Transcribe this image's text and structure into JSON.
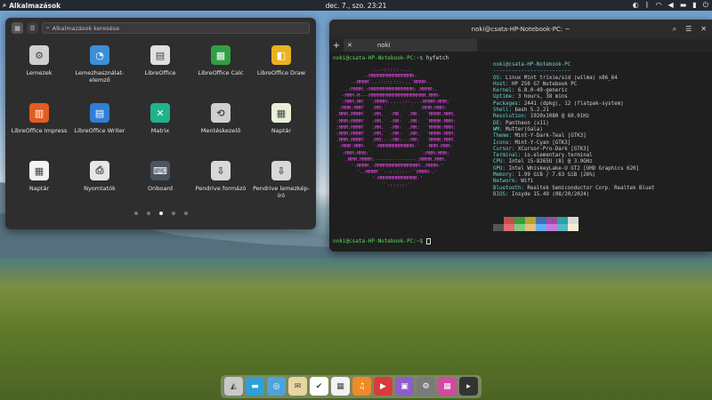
{
  "panel": {
    "apps_label": "Alkalmazások",
    "clock": "dec. 7., szo.   23:21"
  },
  "launcher": {
    "search_placeholder": "Alkalmazások keresése",
    "apps": [
      {
        "label": "Lemezek",
        "icon": "disks-icon",
        "color": "#d0d0d0",
        "glyph": "⚙"
      },
      {
        "label": "Lemezhasználat-elemző",
        "icon": "disk-usage-icon",
        "color": "#3a8fd8",
        "glyph": "◔"
      },
      {
        "label": "LibreOffice",
        "icon": "libreoffice-icon",
        "color": "#e0e0e0",
        "glyph": "▤"
      },
      {
        "label": "LibreOffice Calc",
        "icon": "libreoffice-calc-icon",
        "color": "#2ea043",
        "glyph": "▦"
      },
      {
        "label": "LibreOffice Draw",
        "icon": "libreoffice-draw-icon",
        "color": "#e9b21f",
        "glyph": "◧"
      },
      {
        "label": "LibreOffice Impress",
        "icon": "libreoffice-impress-icon",
        "color": "#e35d1e",
        "glyph": "▥"
      },
      {
        "label": "LibreOffice Writer",
        "icon": "libreoffice-writer-icon",
        "color": "#2f7fd6",
        "glyph": "▤"
      },
      {
        "label": "Matrix",
        "icon": "matrix-icon",
        "color": "#1fb38a",
        "glyph": "✕"
      },
      {
        "label": "Mentéskezelő",
        "icon": "backup-icon",
        "color": "#cfcfcf",
        "glyph": "⟲"
      },
      {
        "label": "Naptár",
        "icon": "calendar-icon",
        "color": "#e8f0d8",
        "glyph": "▦"
      },
      {
        "label": "Naptár",
        "icon": "calendar-red-icon",
        "color": "#f2f2f2",
        "glyph": "▦"
      },
      {
        "label": "Nyomtatók",
        "icon": "printer-icon",
        "color": "#e6e6e6",
        "glyph": "⎙"
      },
      {
        "label": "Onboard",
        "icon": "keyboard-icon",
        "color": "#4a5560",
        "glyph": "⌨"
      },
      {
        "label": "Pendrive formázó",
        "icon": "usb-format-icon",
        "color": "#d8d8d8",
        "glyph": "⇩"
      },
      {
        "label": "Pendrive lemezkép-író",
        "icon": "usb-writer-icon",
        "color": "#d8d8d8",
        "glyph": "⇩"
      }
    ],
    "page_count": 5,
    "active_page": 3
  },
  "terminal": {
    "title": "noki@csata-HP-Notebook-PC: ~",
    "tab_label": "noki",
    "prompt": "noki@csata-HP-Notebook-PC:~$",
    "command": "hyfetch",
    "logo_lines": [
      "             ...-:::::-...",
      "          .-MMMMMMMMMMMMMMM-.",
      "      .-MMMM`..-:::::::-..`MMMM-.",
      "    .:MMMM.:MMMMMMMMMMMMMMM:.MMMM:.",
      "   -MMM-M---MMMMMMMMMMMMMMMMMMM.MMM-",
      "  `:MMM:MM`  :MMMM:....::-...-MMMM:MMM:`",
      "  :MMM:MMM`  :MM:`  `  `  `  :MMM:MMM:",
      " .MMM.MMMM`  :MM.  -MM.  .MM-  `MMMM.MMM.",
      " :MMM:MMMM`  :MM.  -MM-  .MM:  `MMMM-MMM:",
      " :MMM:MMMM`  :MM.  -MM-  .MM:  `MMMM:MMM:",
      " :MMM:MMMM`  :MM.  -MM-  .MM:  `MMMM-MMM:",
      " .MMM.MMMM`  :MM:--:MM:--:MM:  `MMMM.MMM.",
      "  :MMM:MMM-  `-MMMMMMMMMMMM-`  -MMM-MMM:",
      "   :MMM:MMM:`                `:MMM:MMM:",
      "    .MMM.MMMM:--------------:MMMM.MMM.",
      "      '-MMMM.-MMMMMMMMMMMMMMM-.MMMM-'",
      "        '.-MMMM``--:::::--``MMMM-.'",
      "             '-MMMMMMMMMMMMM-'",
      "                ``-:::::-``"
    ],
    "user_host": "noki@csata-HP-Notebook-PC",
    "separator": "-------------------------",
    "info": [
      {
        "key": "OS",
        "value": "Linux Mint trixie/sid (wilma) x86_64"
      },
      {
        "key": "Host",
        "value": "HP 250 G7 Notebook PC"
      },
      {
        "key": "Kernel",
        "value": "6.8.0-49-generic"
      },
      {
        "key": "Uptime",
        "value": "3 hours, 38 mins"
      },
      {
        "key": "Packages",
        "value": "2441 (dpkg), 12 (flatpak-system)"
      },
      {
        "key": "Shell",
        "value": "bash 5.2.21"
      },
      {
        "key": "Resolution",
        "value": "1920x1080 @ 60.01Hz"
      },
      {
        "key": "DE",
        "value": "Pantheon (x11)"
      },
      {
        "key": "WM",
        "value": "Mutter(Gala)"
      },
      {
        "key": "Theme",
        "value": "Mint-Y-Dark-Teal [GTK3]"
      },
      {
        "key": "Icons",
        "value": "Mint-Y-Cyan [GTK3]"
      },
      {
        "key": "Cursor",
        "value": "XCursor-Pro-Dark [GTK3]"
      },
      {
        "key": "Terminal",
        "value": "io.elementary.terminal"
      },
      {
        "key": "CPU",
        "value": "Intel i5-8265U (8) @ 3.9GHz"
      },
      {
        "key": "GPU",
        "value": "Intel WhiskeyLake-U GT2 [UHD Graphics 620]"
      },
      {
        "key": "Memory",
        "value": "1.99 GiB / 7.63 GiB (26%)"
      },
      {
        "key": "Network",
        "value": "Wifi"
      },
      {
        "key": "Bluetooth",
        "value": "Realtek Semiconductor Corp. Realtek Bluet"
      },
      {
        "key": "BIOS",
        "value": "Insyde 15.49 (08/20/2024)"
      }
    ],
    "swatch_colors": [
      "#1e1e1e",
      "#c0504d",
      "#3c9a3c",
      "#b8a030",
      "#3b6fb5",
      "#a04aa0",
      "#2aa0a8",
      "#d8d8d8",
      "#555555",
      "#e06c75",
      "#7fc97f",
      "#e5c07b",
      "#61afef",
      "#c678dd",
      "#56b6c2",
      "#f5ecd8"
    ]
  },
  "dock": [
    {
      "name": "dock-app-multitasking-icon",
      "color": "#c8c8c8",
      "glyph": "◭"
    },
    {
      "name": "dock-app-files-icon",
      "color": "#2f9fd8",
      "glyph": "▬"
    },
    {
      "name": "dock-app-browser-icon",
      "color": "#4fa3d8",
      "glyph": "◎"
    },
    {
      "name": "dock-app-mail-icon",
      "color": "#e8d5a0",
      "glyph": "✉"
    },
    {
      "name": "dock-app-tasks-icon",
      "color": "#ffffff",
      "glyph": "✔"
    },
    {
      "name": "dock-app-calendar-icon",
      "color": "#f2f2f2",
      "glyph": "▦"
    },
    {
      "name": "dock-app-music-icon",
      "color": "#f08a24",
      "glyph": "♫"
    },
    {
      "name": "dock-app-videos-icon",
      "color": "#d83b3b",
      "glyph": "▶"
    },
    {
      "name": "dock-app-photos-icon",
      "color": "#8a5fc8",
      "glyph": "▣"
    },
    {
      "name": "dock-app-settings-icon",
      "color": "#7a7a7a",
      "glyph": "⚙"
    },
    {
      "name": "dock-app-appcenter-icon",
      "color": "#d04aa0",
      "glyph": "▦"
    },
    {
      "name": "dock-app-terminal-icon",
      "color": "#333333",
      "glyph": "▸"
    }
  ]
}
